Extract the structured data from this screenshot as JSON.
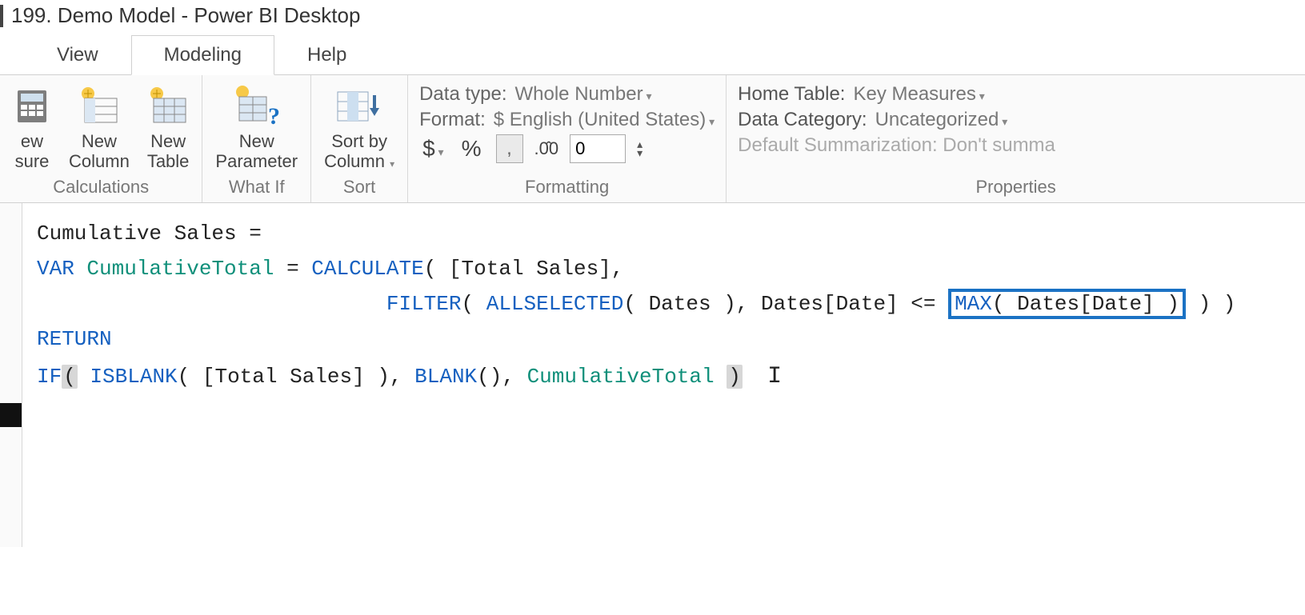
{
  "window": {
    "title": "199. Demo Model - Power BI Desktop"
  },
  "tabs": {
    "view": "View",
    "modeling": "Modeling",
    "help": "Help"
  },
  "ribbon": {
    "calculations": {
      "new_measure": "ew\nsure",
      "new_column": "New\nColumn",
      "new_table": "New\nTable",
      "group": "Calculations"
    },
    "whatif": {
      "new_parameter": "New\nParameter",
      "group": "What If"
    },
    "sort": {
      "sort_by_column": "Sort by\nColumn",
      "group": "Sort"
    },
    "formatting": {
      "data_type_label": "Data type:",
      "data_type_value": "Whole Number",
      "format_label": "Format:",
      "format_value": "$ English (United States)",
      "currency": "$",
      "percent": "%",
      "comma": ",",
      "decimal_icon": ".00",
      "decimals_value": "0",
      "group": "Formatting"
    },
    "properties": {
      "home_table_label": "Home Table:",
      "home_table_value": "Key Measures",
      "data_category_label": "Data Category:",
      "data_category_value": "Uncategorized",
      "default_summ": "Default Summarization: Don't summa",
      "group": "Properties"
    }
  },
  "formula": {
    "line1_a": "Cumulative Sales = ",
    "var": "VAR",
    "cumvar": "CumulativeTotal",
    "eq": " = ",
    "calculate": "CALCULATE",
    "totalsales": "[Total Sales]",
    "filter": "FILTER",
    "allselected": "ALLSELECTED",
    "dates": "Dates",
    "datesdate": "Dates[Date]",
    "lte": " <= ",
    "max": "MAX",
    "return": "RETURN",
    "if": "IF",
    "isblank": "ISBLANK",
    "blank": "BLANK"
  }
}
